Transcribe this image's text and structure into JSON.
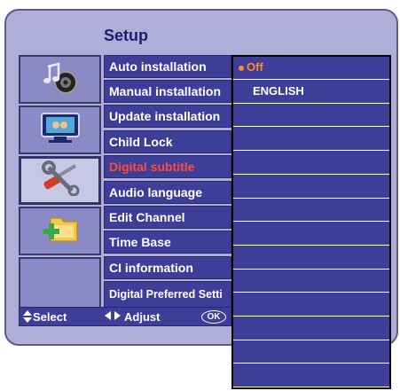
{
  "title": "Setup",
  "categories": [
    {
      "icon": "music-speaker-icon"
    },
    {
      "icon": "tv-screen-icon"
    },
    {
      "icon": "tools-icon",
      "active": true
    },
    {
      "icon": "folder-add-icon"
    },
    {
      "icon": ""
    }
  ],
  "menu_items": [
    {
      "label": "Auto installation"
    },
    {
      "label": "Manual installation"
    },
    {
      "label": "Update installation"
    },
    {
      "label": "Child Lock"
    },
    {
      "label": "Digital subtitle",
      "selected": true
    },
    {
      "label": "Audio language"
    },
    {
      "label": "Edit Channel"
    },
    {
      "label": "Time Base"
    },
    {
      "label": "CI information"
    },
    {
      "label": "Digital Preferred Setti"
    }
  ],
  "values": [
    {
      "text": "Off",
      "marker": true
    },
    {
      "text": "ENGLISH"
    },
    {
      "text": ""
    },
    {
      "text": ""
    },
    {
      "text": ""
    },
    {
      "text": ""
    },
    {
      "text": ""
    },
    {
      "text": ""
    },
    {
      "text": ""
    },
    {
      "text": ""
    },
    {
      "text": ""
    },
    {
      "text": ""
    },
    {
      "text": ""
    },
    {
      "text": ""
    }
  ],
  "bottom_bar": {
    "select_label": "Select",
    "adjust_label": "Adjust",
    "ok_label": "OK"
  },
  "colors": {
    "panel_bg": "#aeaed8",
    "menu_bg": "#3c3e97",
    "selected_text": "#ff4a3a",
    "marker": "#ff8a2a",
    "title": "#1a1f6e"
  }
}
